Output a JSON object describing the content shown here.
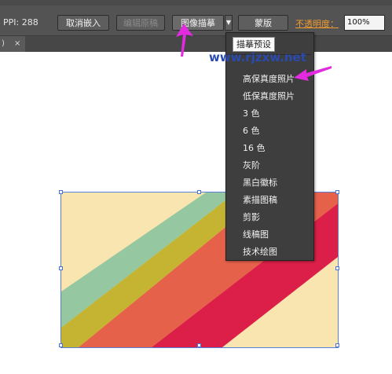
{
  "toolbar": {
    "ppi": "PPI: 288",
    "cancel_embed": "取消嵌入",
    "edit_original": "编辑原稿",
    "image_trace": "图像描摹",
    "mask": "蒙版",
    "opacity_label": "不透明度：",
    "opacity_value": "100%"
  },
  "tab": {
    "paren": ")",
    "close": "×"
  },
  "menu": {
    "title": "描摹预设",
    "items": [
      "高保真度照片",
      "低保真度照片",
      "3 色",
      "6 色",
      "16 色",
      "灰阶",
      "黑白徽标",
      "素描图稿",
      "剪影",
      "线稿图",
      "技术绘图"
    ]
  },
  "watermark": "www.rjzxw.net",
  "colors": {
    "toolbar_bg": "#535353",
    "menu_bg": "#3e3e3e",
    "accent_orange": "#f39b2f",
    "annotation_magenta": "#e22be0",
    "selection_blue": "#4a73d6",
    "stripe_cream": "#f9e5b0",
    "stripe_green": "#95c7a1",
    "stripe_olive": "#c4b432",
    "stripe_orange": "#e6614a",
    "stripe_crimson": "#dc1f48"
  }
}
